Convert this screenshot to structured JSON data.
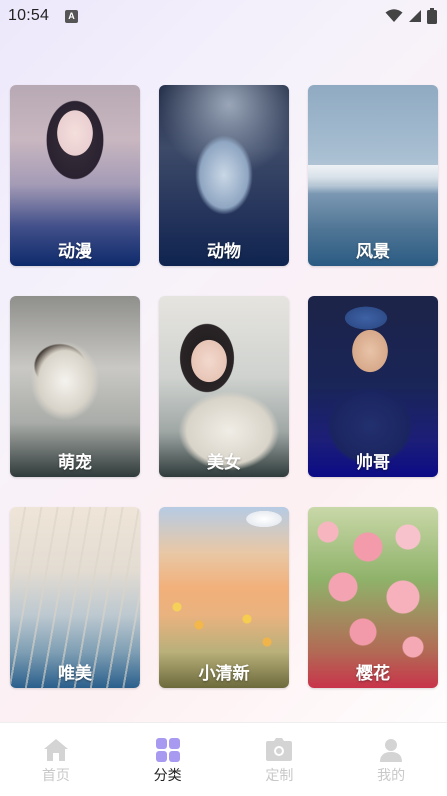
{
  "status_bar": {
    "time": "10:54",
    "notification_letter": "A"
  },
  "categories": [
    {
      "label": "动漫"
    },
    {
      "label": "动物"
    },
    {
      "label": "风景"
    },
    {
      "label": "萌宠"
    },
    {
      "label": "美女"
    },
    {
      "label": "帅哥"
    },
    {
      "label": "唯美"
    },
    {
      "label": "小清新"
    },
    {
      "label": "樱花"
    }
  ],
  "tab_bar": {
    "active_index": 1,
    "accent_color": "#a89af0",
    "inactive_color": "#d4d4d4",
    "tabs": [
      {
        "label": "首页",
        "icon": "home-icon"
      },
      {
        "label": "分类",
        "icon": "category-grid-icon"
      },
      {
        "label": "定制",
        "icon": "camera-icon"
      },
      {
        "label": "我的",
        "icon": "profile-icon"
      }
    ]
  }
}
